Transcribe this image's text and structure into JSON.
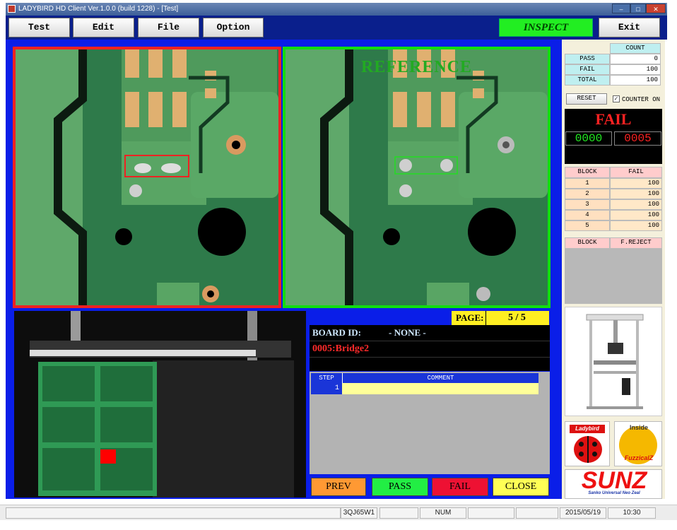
{
  "window": {
    "title": "LADYBIRD HD Client Ver.1.0.0  (build 1228) - [Test]",
    "controls": [
      "–",
      "□",
      "✕"
    ]
  },
  "toolbar": {
    "menus": [
      "Test",
      "Edit",
      "File",
      "Option"
    ],
    "mode": "INSPECT",
    "exit_label": "Exit"
  },
  "camera": {
    "reference_label": "REFERENCE"
  },
  "inspection": {
    "page_label": "PAGE:",
    "page_value": "5 / 5",
    "board_id_label": "BOARD ID:",
    "board_id_value": "- NONE -",
    "defect": "0005:Bridge2",
    "step_header": "STEP",
    "comment_header": "COMMENT",
    "rows": [
      {
        "step": "1",
        "comment": ""
      }
    ],
    "buttons": {
      "prev": "PREV",
      "pass": "PASS",
      "fail": "FAIL",
      "close": "CLOSE"
    }
  },
  "counter": {
    "header": "COUNT",
    "rows": [
      {
        "label": "PASS",
        "value": "0"
      },
      {
        "label": "FAIL",
        "value": "100"
      },
      {
        "label": "TOTAL",
        "value": "100"
      }
    ],
    "reset_label": "RESET",
    "counter_on_label": "COUNTER ON",
    "counter_on": true
  },
  "result": {
    "status": "FAIL",
    "left_count": "0000",
    "right_count": "0005"
  },
  "blocks": {
    "header_block": "BLOCK",
    "header_fail": "FAIL",
    "rows": [
      {
        "block": "1",
        "fail": "100"
      },
      {
        "block": "2",
        "fail": "100"
      },
      {
        "block": "3",
        "fail": "100"
      },
      {
        "block": "4",
        "fail": "100"
      },
      {
        "block": "5",
        "fail": "100"
      }
    ]
  },
  "reject": {
    "header_block": "BLOCK",
    "header_reject": "F.REJECT"
  },
  "logos": {
    "ladybird": "Ladybird",
    "inside": "Inside",
    "fuzzicalz": "FuzzicalZ",
    "sunz": "SUNZ",
    "sunz_tagline": "Sanko Universal Neo Zeal"
  },
  "statusbar": {
    "code": "3QJ65W1",
    "num": "NUM",
    "date": "2015/05/19",
    "time": "10:30"
  },
  "colors": {
    "toolbar_bg": "#0a1f8c",
    "main_bg": "#0a1ee8",
    "fail_red": "#e22222",
    "pass_green": "#22ee22",
    "highlight_yellow": "#ffee22"
  }
}
